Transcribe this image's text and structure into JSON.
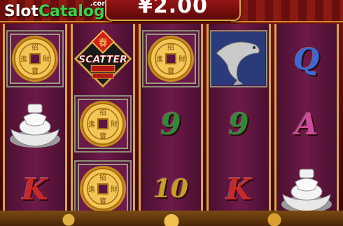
{
  "watermark": {
    "prefix": "Slot",
    "brand": "Catalog",
    "tld": ".com"
  },
  "win_amount": "¥2.00",
  "colors": {
    "reel_bg": "#6d1a48",
    "gold": "#d7a640",
    "green_letter": "#2f8a36",
    "red_letter": "#c8282a",
    "pink_letter": "#d04a9a",
    "blue_letter": "#3a6ad6"
  },
  "reels": [
    [
      {
        "symbol": "coin-icon",
        "label": ""
      },
      {
        "symbol": "ingot-icon",
        "label": ""
      },
      {
        "symbol": "letter",
        "label": "K",
        "color": "#c8282a"
      }
    ],
    [
      {
        "symbol": "scatter-icon",
        "label": "SCATTER",
        "badge": "春"
      },
      {
        "symbol": "coin-icon",
        "label": ""
      },
      {
        "symbol": "coin-icon",
        "label": ""
      }
    ],
    [
      {
        "symbol": "coin-icon",
        "label": ""
      },
      {
        "symbol": "letter",
        "label": "9",
        "color": "#2f8a36"
      },
      {
        "symbol": "letter",
        "label": "10",
        "color": "#c8a020"
      }
    ],
    [
      {
        "symbol": "fish-icon",
        "label": ""
      },
      {
        "symbol": "letter",
        "label": "9",
        "color": "#2f8a36"
      },
      {
        "symbol": "letter",
        "label": "K",
        "color": "#c8282a"
      }
    ],
    [
      {
        "symbol": "letter",
        "label": "Q",
        "color": "#3a6ad6"
      },
      {
        "symbol": "letter",
        "label": "A",
        "color": "#d04a9a"
      },
      {
        "symbol": "ingot-icon",
        "label": ""
      }
    ]
  ],
  "coin_chars": [
    "招",
    "財",
    "進",
    "寶"
  ]
}
